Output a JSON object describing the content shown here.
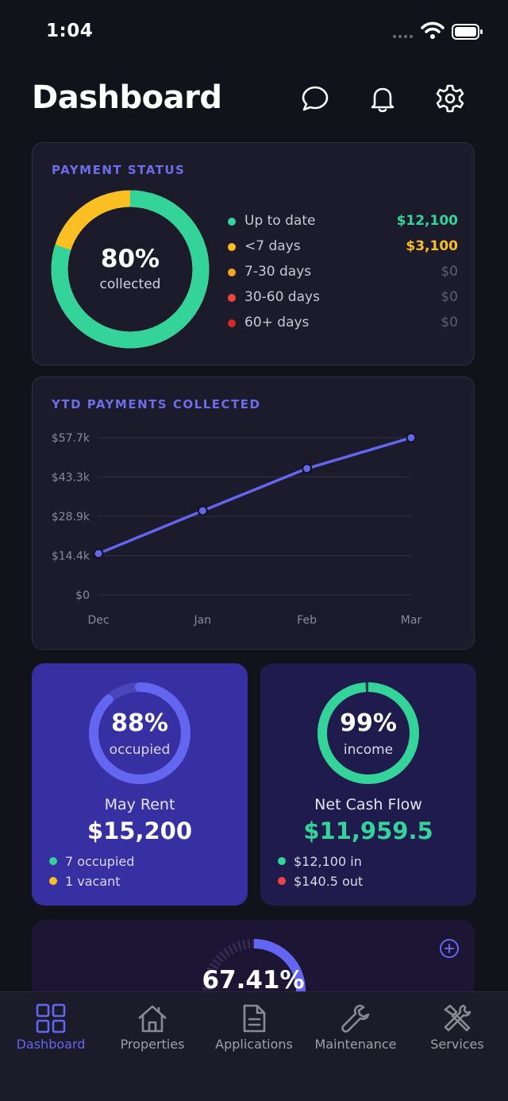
{
  "status_bar": {
    "time": "1:04"
  },
  "header": {
    "title": "Dashboard",
    "icons": [
      "chat-icon",
      "bell-icon",
      "gear-icon"
    ]
  },
  "payment_status": {
    "label": "PAYMENT STATUS",
    "percent": "80%",
    "percent_caption": "collected",
    "collected_fraction": 0.8,
    "legend": [
      {
        "label": "Up to date",
        "amount": "$12,100",
        "dot_color": "#34d399",
        "amount_color": "#34d399"
      },
      {
        "label": "<7 days",
        "amount": "$3,100",
        "dot_color": "#fbbf24",
        "amount_color": "#fbbf24"
      },
      {
        "label": "7-30 days",
        "amount": "$0",
        "dot_color": "#f5a524",
        "amount_color": "#5e5e6e"
      },
      {
        "label": "30-60 days",
        "amount": "$0",
        "dot_color": "#ef4444",
        "amount_color": "#5e5e6e"
      },
      {
        "label": "60+ days",
        "amount": "$0",
        "dot_color": "#dc2626",
        "amount_color": "#5e5e6e"
      }
    ],
    "colors": {
      "up_to_date": "#34d399",
      "late": "#fbbf24"
    }
  },
  "ytd": {
    "label": "YTD PAYMENTS COLLECTED"
  },
  "chart_data": {
    "type": "line",
    "title": "YTD PAYMENTS COLLECTED",
    "categories": [
      "Dec",
      "Jan",
      "Feb",
      "Mar"
    ],
    "y_tick_labels": [
      "$0",
      "$14.4k",
      "$28.9k",
      "$43.3k",
      "$57.7k"
    ],
    "ylim": [
      0,
      57700
    ],
    "values": [
      15200,
      30900,
      46400,
      57700
    ],
    "line_color": "#6366f1",
    "grid": true
  },
  "rent_tile": {
    "percent": "88%",
    "percent_caption": "occupied",
    "fraction": 0.88,
    "name": "May Rent",
    "value": "$15,200",
    "bullets": [
      {
        "text": "7 occupied",
        "color": "#34d399"
      },
      {
        "text": "1 vacant",
        "color": "#fbbf24"
      }
    ]
  },
  "cash_tile": {
    "percent": "99%",
    "percent_caption": "income",
    "fraction": 0.99,
    "name": "Net Cash Flow",
    "value": "$11,959.5",
    "bullets": [
      {
        "text": "$12,100 in",
        "color": "#34d399"
      },
      {
        "text": "$140.5 out",
        "color": "#ef4444"
      }
    ]
  },
  "partial_card": {
    "percent": "67.41%",
    "fraction": 0.6741
  },
  "tabs": [
    {
      "label": "Dashboard",
      "icon": "grid-icon",
      "active": true
    },
    {
      "label": "Properties",
      "icon": "home-icon",
      "active": false
    },
    {
      "label": "Applications",
      "icon": "document-icon",
      "active": false
    },
    {
      "label": "Maintenance",
      "icon": "wrench-icon",
      "active": false
    },
    {
      "label": "Services",
      "icon": "tools-icon",
      "active": false
    }
  ]
}
